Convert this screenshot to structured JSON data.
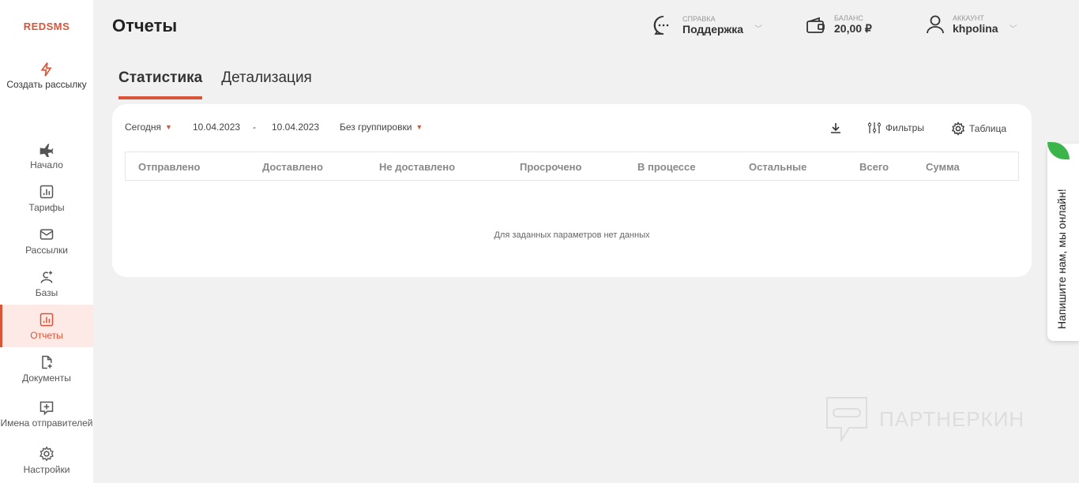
{
  "logo": "REDSMS",
  "create": "Создать рассылку",
  "nav": [
    {
      "label": "Начало",
      "icon": "plane-icon"
    },
    {
      "label": "Тарифы",
      "icon": "chart-icon"
    },
    {
      "label": "Рассылки",
      "icon": "mail-icon"
    },
    {
      "label": "Базы",
      "icon": "user-add-icon"
    },
    {
      "label": "Отчеты",
      "icon": "chart-icon",
      "active": true
    },
    {
      "label": "Документы",
      "icon": "document-add-icon"
    },
    {
      "label": "Имена отправителей",
      "icon": "message-add-icon"
    },
    {
      "label": "Настройки",
      "icon": "gear-icon"
    }
  ],
  "page_title": "Отчеты",
  "header": {
    "help": {
      "caption": "Справка",
      "value": "Поддержка"
    },
    "balance": {
      "caption": "Баланс",
      "value": "20,00 ₽"
    },
    "account": {
      "caption": "Аккаунт",
      "value": "khpolina"
    }
  },
  "tabs": [
    {
      "label": "Статистика",
      "active": true
    },
    {
      "label": "Детализация"
    }
  ],
  "toolbar": {
    "period": "Сегодня",
    "date_from": "10.04.2023",
    "date_sep": "-",
    "date_to": "10.04.2023",
    "grouping": "Без группировки",
    "filters": "Фильтры",
    "table": "Таблица"
  },
  "columns": [
    "Отправлено",
    "Доставлено",
    "Не доставлено",
    "Просрочено",
    "В процессе",
    "Остальные",
    "Всего",
    "Сумма"
  ],
  "empty": "Для заданных параметров нет данных",
  "chat": "Напишите нам, мы онлайн!",
  "watermark": "ПАРТНЕРКИН",
  "accent": "#d9553a"
}
